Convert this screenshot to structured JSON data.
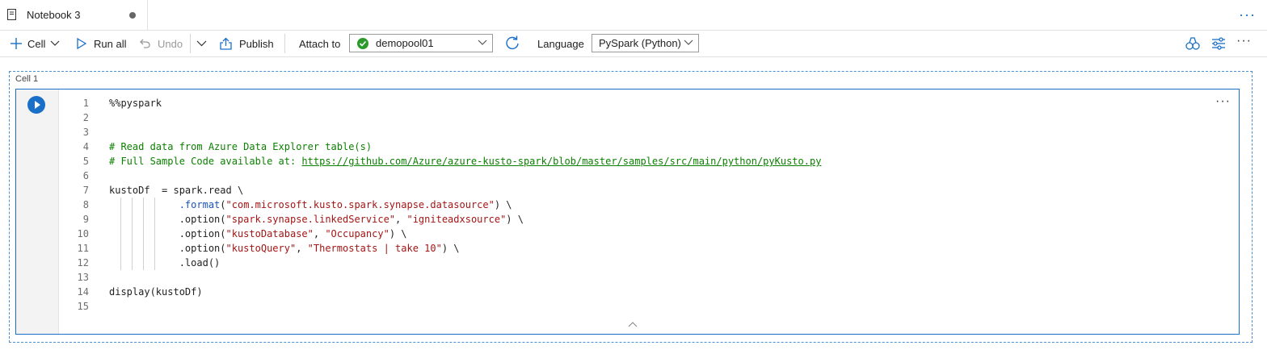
{
  "tab": {
    "title": "Notebook 3"
  },
  "toolbar": {
    "cell_label": "Cell",
    "run_all_label": "Run all",
    "undo_label": "Undo",
    "publish_label": "Publish",
    "attach_to_label": "Attach to",
    "pool_value": "demopool01",
    "language_label": "Language",
    "language_value": "PySpark (Python)"
  },
  "cell": {
    "label": "Cell 1",
    "lines": [
      {
        "n": "1",
        "parts": [
          {
            "t": "%%pyspark",
            "c": ""
          }
        ]
      },
      {
        "n": "2",
        "parts": []
      },
      {
        "n": "3",
        "parts": []
      },
      {
        "n": "4",
        "parts": [
          {
            "t": "# Read data from Azure Data Explorer table(s)",
            "c": "comment"
          }
        ]
      },
      {
        "n": "5",
        "parts": [
          {
            "t": "# Full Sample Code available at: ",
            "c": "comment"
          },
          {
            "t": "https://github.com/Azure/azure-kusto-spark/blob/master/samples/src/main/python/pyKusto.py",
            "c": "link"
          }
        ]
      },
      {
        "n": "6",
        "parts": []
      },
      {
        "n": "7",
        "parts": [
          {
            "t": "kustoDf  = spark.read \\",
            "c": ""
          }
        ]
      },
      {
        "n": "8",
        "parts": [
          {
            "t": "            ",
            "c": ""
          },
          {
            "t": ".format",
            "c": "fn"
          },
          {
            "t": "(",
            "c": ""
          },
          {
            "t": "\"com.microsoft.kusto.spark.synapse.datasource\"",
            "c": "str"
          },
          {
            "t": ") \\",
            "c": ""
          }
        ]
      },
      {
        "n": "9",
        "parts": [
          {
            "t": "            .option(",
            "c": ""
          },
          {
            "t": "\"spark.synapse.linkedService\"",
            "c": "str"
          },
          {
            "t": ", ",
            "c": ""
          },
          {
            "t": "\"igniteadxsource\"",
            "c": "str"
          },
          {
            "t": ") \\",
            "c": ""
          }
        ]
      },
      {
        "n": "10",
        "parts": [
          {
            "t": "            .option(",
            "c": ""
          },
          {
            "t": "\"kustoDatabase\"",
            "c": "str"
          },
          {
            "t": ", ",
            "c": ""
          },
          {
            "t": "\"Occupancy\"",
            "c": "str"
          },
          {
            "t": ") \\",
            "c": ""
          }
        ]
      },
      {
        "n": "11",
        "parts": [
          {
            "t": "            .option(",
            "c": ""
          },
          {
            "t": "\"kustoQuery\"",
            "c": "str"
          },
          {
            "t": ", ",
            "c": ""
          },
          {
            "t": "\"Thermostats | take 10\"",
            "c": "str"
          },
          {
            "t": ") \\",
            "c": ""
          }
        ]
      },
      {
        "n": "12",
        "parts": [
          {
            "t": "            .load()",
            "c": ""
          }
        ]
      },
      {
        "n": "13",
        "parts": []
      },
      {
        "n": "14",
        "parts": [
          {
            "t": "display(kustoDf)",
            "c": ""
          }
        ]
      },
      {
        "n": "15",
        "parts": []
      }
    ]
  },
  "colors": {
    "accent": "#1a70c9",
    "comment": "#0b8000",
    "string": "#a31515",
    "ok": "#2b9a2b"
  }
}
